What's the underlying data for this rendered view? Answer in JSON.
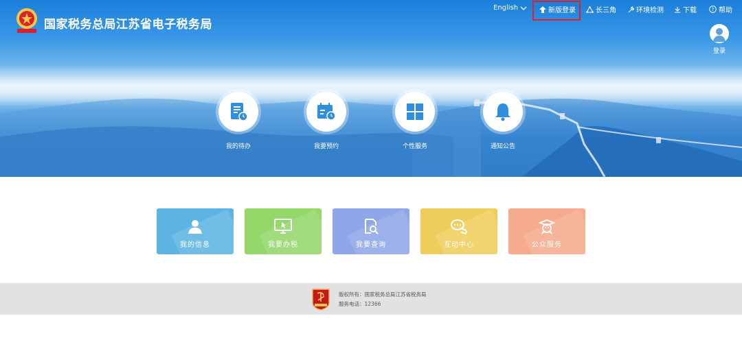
{
  "header": {
    "title": "国家税务总局江苏省电子税务局"
  },
  "topnav": {
    "language": "English",
    "new_login": "新版登录",
    "yangtze_delta": "长三角",
    "env_check": "环境检测",
    "download": "下载",
    "help": "帮助",
    "highlight_color": "#e2202a"
  },
  "login": {
    "label": "登录"
  },
  "hero": [
    {
      "label": "我的待办",
      "icon": "document-clock-icon"
    },
    {
      "label": "我要预约",
      "icon": "calendar-clock-icon"
    },
    {
      "label": "个性服务",
      "icon": "grid-icon"
    },
    {
      "label": "通知公告",
      "icon": "bell-icon"
    }
  ],
  "tiles": [
    {
      "label": "我的信息",
      "icon": "user-icon",
      "color": "#5db4e2"
    },
    {
      "label": "我要办税",
      "icon": "monitor-cursor-icon",
      "color": "#94d86a"
    },
    {
      "label": "我要查询",
      "icon": "doc-search-icon",
      "color": "#8fa6e8"
    },
    {
      "label": "互动中心",
      "icon": "chat-bubbles-icon",
      "color": "#efcd5c"
    },
    {
      "label": "公众服务",
      "icon": "mascot-icon",
      "color": "#f5ab8e"
    }
  ],
  "footer": {
    "copyright": "版权所有：国家税务总局江苏省税务局",
    "phone": "服务电话：12366"
  }
}
